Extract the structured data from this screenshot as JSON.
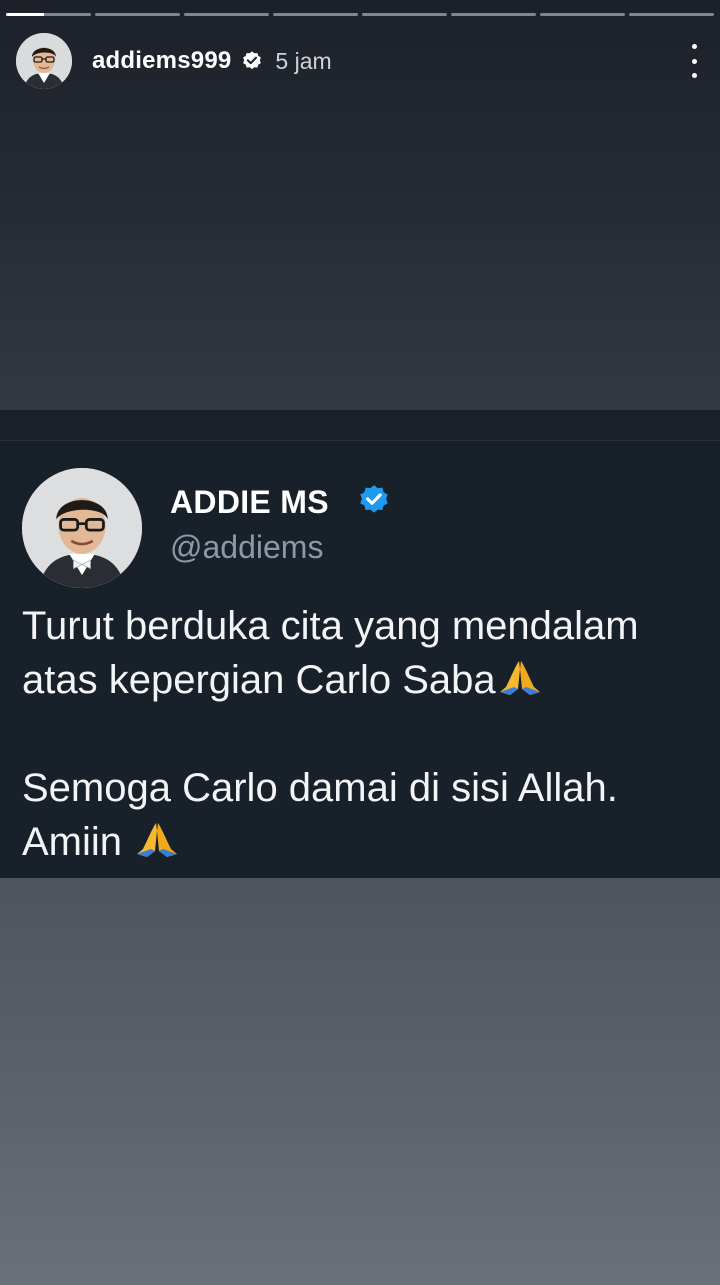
{
  "story": {
    "progress_segments": [
      1,
      0,
      0,
      0,
      0,
      0,
      0,
      0
    ],
    "current_segment_fill": 0.45,
    "username": "addiems999",
    "verified": true,
    "time_ago": "5 jam",
    "more_icon": "more-vertical-icon"
  },
  "tweet": {
    "display_name": "ADDIE MS",
    "handle": "@addiems",
    "verified": true,
    "verified_color": "#1d9bf0",
    "line1": "Turut berduka cita yang mendalam",
    "line2": "atas kepergian Carlo Saba",
    "line3": "Semoga Carlo damai di sisi Allah.",
    "line4": "Amiin",
    "emoji": "folded-hands-icon"
  },
  "colors": {
    "background_top": "#1c2029",
    "card_background": "#18202a",
    "handle_gray": "#8b98a5"
  }
}
